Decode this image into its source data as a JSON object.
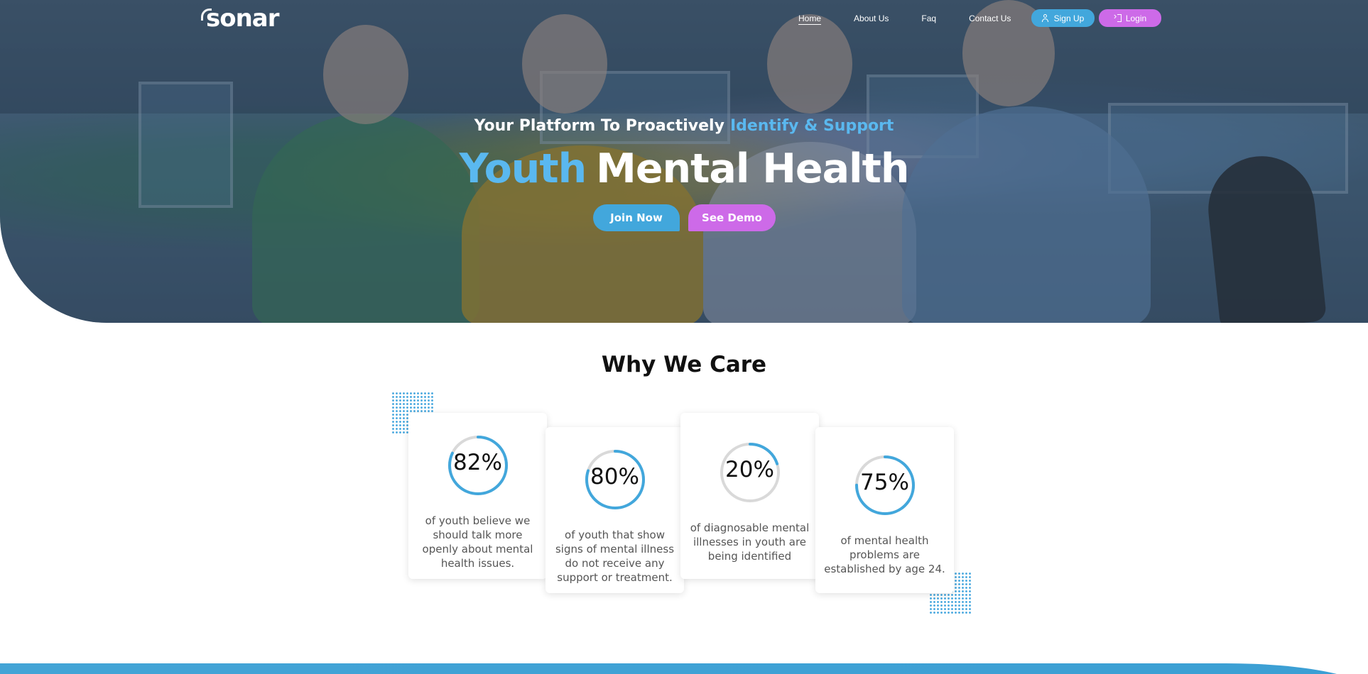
{
  "brand": {
    "logo_text": "sonar"
  },
  "nav": {
    "links": [
      {
        "label": "Home",
        "active": true
      },
      {
        "label": "About Us",
        "active": false
      },
      {
        "label": "Faq",
        "active": false
      },
      {
        "label": "Contact Us",
        "active": false
      }
    ],
    "signup_label": "Sign Up",
    "login_label": "Login"
  },
  "hero": {
    "subhead_prefix": "Your Platform To Proactively",
    "subhead_accent": "Identify & Support",
    "headline_accent": "Youth",
    "headline_rest": "Mental Health",
    "join_label": "Join Now",
    "demo_label": "See Demo"
  },
  "why": {
    "title": "Why We Care",
    "stats": [
      {
        "value": "82%",
        "percent": 82,
        "text": "of youth believe we should talk more openly about mental health issues."
      },
      {
        "value": "80%",
        "percent": 80,
        "text": "of youth that show signs of mental illness do not receive any support or treatment."
      },
      {
        "value": "20%",
        "percent": 20,
        "text": "of diagnosable mental illnesses in youth are being identified"
      },
      {
        "value": "75%",
        "percent": 75,
        "text": "of mental health problems are established by age 24."
      }
    ]
  },
  "colors": {
    "blue": "#42a7dc",
    "purple": "#cd6ae8",
    "accent_text": "#5ab8ef",
    "ring_track": "#d9d9d9"
  },
  "icons": {
    "signup": "user-add-icon",
    "login": "login-icon"
  }
}
